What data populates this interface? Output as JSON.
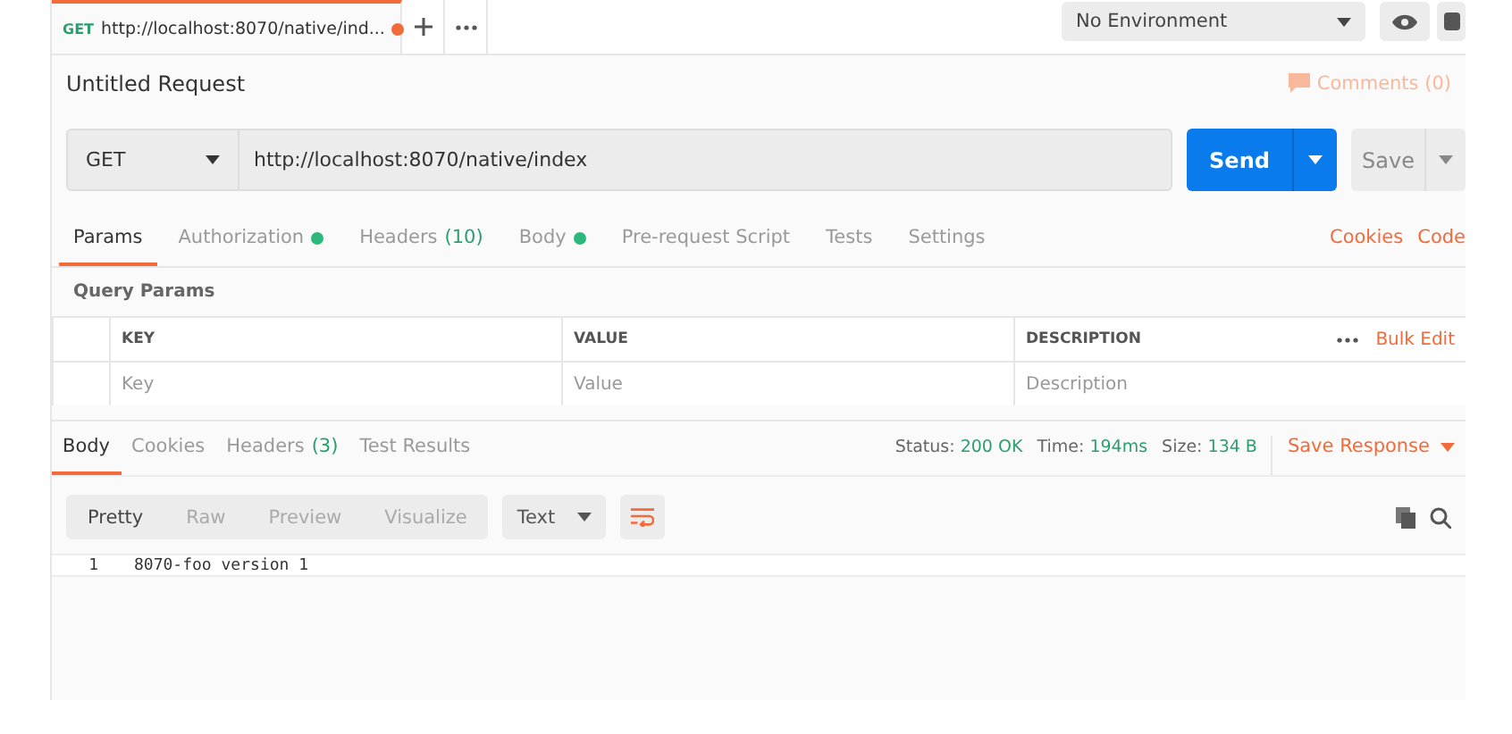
{
  "request_tabs": [
    {
      "method": "GET",
      "label": "http://localhost:8070/native/ind...",
      "unsaved": true,
      "selected": true
    }
  ],
  "environment": {
    "value": "No Environment"
  },
  "request": {
    "title": "Untitled Request",
    "comments": "Comments (0)",
    "method": "GET",
    "url": "http://localhost:8070/native/index",
    "send": "Send",
    "save": "Save"
  },
  "request_sections": [
    {
      "label": "Params",
      "selected": true
    },
    {
      "label": "Authorization",
      "dot": true,
      "selected": false
    },
    {
      "label": "Headers",
      "count": "(10)",
      "selected": false
    },
    {
      "label": "Body",
      "dot": true,
      "selected": false
    },
    {
      "label": "Pre-request Script",
      "selected": false
    },
    {
      "label": "Tests",
      "selected": false
    },
    {
      "label": "Settings",
      "selected": false
    }
  ],
  "request_links": [
    "Cookies",
    "Code"
  ],
  "query_params": {
    "title": "Query Params",
    "columns": [
      "KEY",
      "VALUE",
      "DESCRIPTION"
    ],
    "bulk_edit": "Bulk Edit",
    "placeholders": [
      "Key",
      "Value",
      "Description"
    ]
  },
  "response_sections": [
    {
      "label": "Body",
      "selected": true
    },
    {
      "label": "Cookies",
      "selected": false
    },
    {
      "label": "Headers",
      "count": "(3)",
      "selected": false
    },
    {
      "label": "Test Results",
      "selected": false
    }
  ],
  "status": [
    {
      "label": "Status:",
      "value": "200 OK"
    },
    {
      "label": "Time:",
      "value": "194ms"
    },
    {
      "label": "Size:",
      "value": "134 B"
    }
  ],
  "save_response": "Save Response",
  "view_modes": [
    {
      "label": "Pretty",
      "selected": true
    },
    {
      "label": "Raw",
      "selected": false
    },
    {
      "label": "Preview",
      "selected": false
    },
    {
      "label": "Visualize",
      "selected": false
    }
  ],
  "format": "Text",
  "code_lines": [
    {
      "number": "1",
      "text": "8070-foo version 1"
    }
  ]
}
